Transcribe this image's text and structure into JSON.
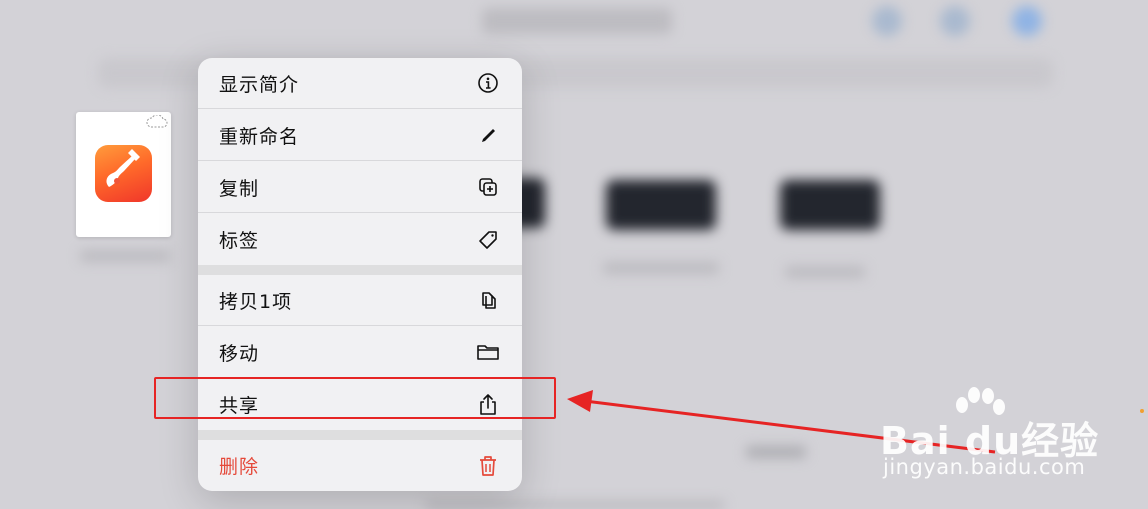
{
  "menu": {
    "items": [
      {
        "label": "显示简介",
        "icon": "info-circle-icon"
      },
      {
        "label": "重新命名",
        "icon": "pencil-icon"
      },
      {
        "label": "复制",
        "icon": "duplicate-icon"
      },
      {
        "label": "标签",
        "icon": "tag-icon"
      },
      {
        "label": "拷贝1项",
        "icon": "copy-doc-icon"
      },
      {
        "label": "移动",
        "icon": "folder-icon"
      },
      {
        "label": "共享",
        "icon": "share-icon"
      },
      {
        "label": "删除",
        "icon": "trash-icon",
        "destructive": true
      }
    ]
  },
  "file": {
    "app_icon": "garageband-app-icon",
    "status_icon": "cloud-icon"
  },
  "annotation": {
    "highlight_color": "#e62424",
    "arrow_color": "#e62424"
  },
  "watermark": {
    "main": "Bai du经验",
    "sub": "jingyan.baidu.com"
  },
  "colors": {
    "destructive": "#e5493a",
    "menu_bg": "#f1f1f3"
  }
}
